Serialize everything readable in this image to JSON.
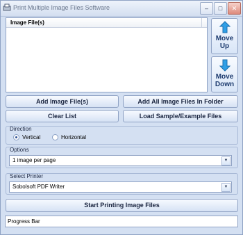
{
  "window": {
    "title": "Print Multiple Image Files Software"
  },
  "list": {
    "column_header": "Image File(s)"
  },
  "side_buttons": {
    "move_up": "Move Up",
    "move_down": "Move Down"
  },
  "buttons": {
    "add_files": "Add Image File(s)",
    "add_folder": "Add All Image Files In Folder",
    "clear_list": "Clear List",
    "load_samples": "Load Sample/Example Files",
    "start": "Start Printing Image Files"
  },
  "direction": {
    "label": "Direction",
    "vertical": "Vertical",
    "horizontal": "Horizontal",
    "selected": "Vertical"
  },
  "options": {
    "label": "Options",
    "value": "1 image per page"
  },
  "printer": {
    "label": "Select Printer",
    "value": "Sobolsoft PDF Writer"
  },
  "status": {
    "progress_text": "Progress Bar"
  },
  "colors": {
    "accent": "#2f9fe6",
    "frame": "#d4e0f2",
    "border": "#8fa2c4"
  },
  "icons": [
    "app-icon",
    "minimize-icon",
    "maximize-icon",
    "close-icon",
    "arrow-up-icon",
    "arrow-down-icon",
    "chevron-down-icon"
  ]
}
